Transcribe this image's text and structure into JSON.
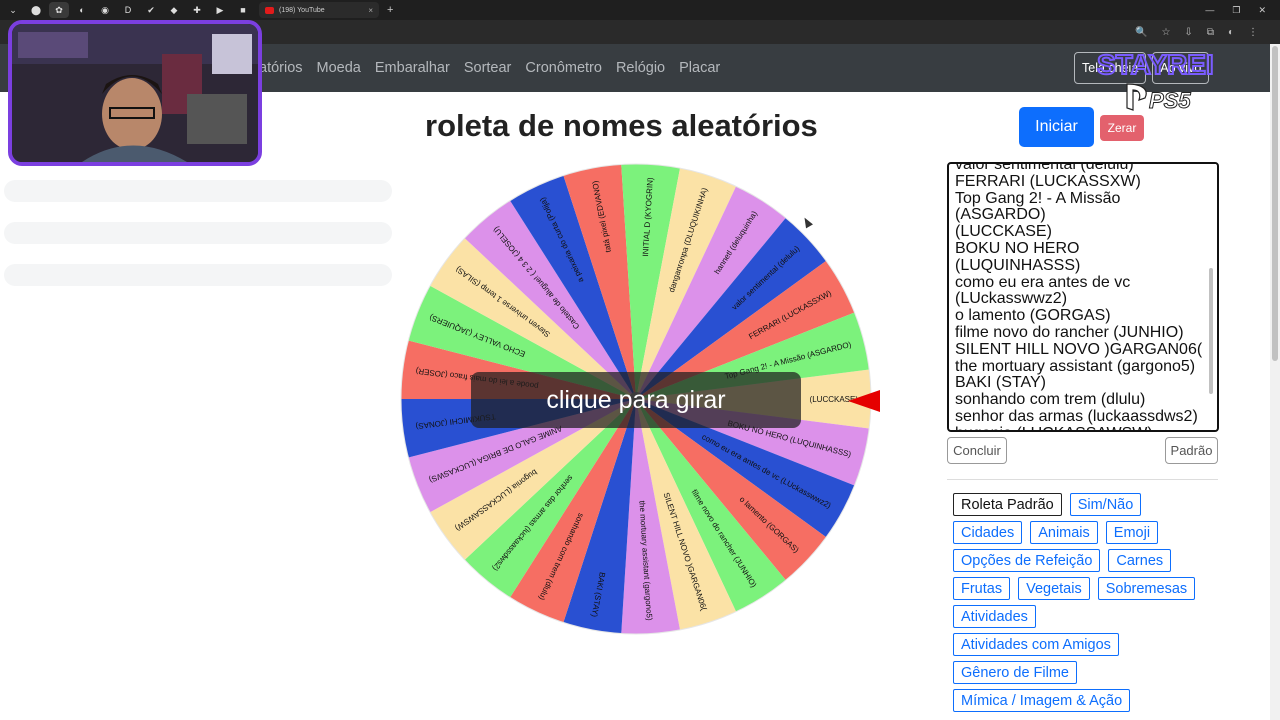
{
  "browser": {
    "tab_title": "(198) YouTube",
    "tab_close": "×",
    "new_tab": "+",
    "tab_icons": [
      "⌄",
      "⬤",
      "✿",
      "◐",
      "◉",
      "D",
      "✔",
      "◆",
      "✚",
      "▶",
      "■"
    ],
    "window_controls": [
      "—",
      "❐",
      "✕"
    ],
    "address_icons": [
      "🔍",
      "☆",
      "⇩",
      "⧉",
      "◐",
      "⋮"
    ]
  },
  "nav": {
    "links": [
      "atórios",
      "Moeda",
      "Embaralhar",
      "Sortear",
      "Cronômetro",
      "Relógio",
      "Placar"
    ],
    "buttons": [
      "Tela cheia",
      "Ao vivo"
    ]
  },
  "brand": {
    "overlay_text": "STAYREI",
    "logo_text": "PS5"
  },
  "page": {
    "title": "roleta de nomes aleatórios"
  },
  "controls": {
    "start": "Iniciar",
    "reset": "Zerar"
  },
  "wheel": {
    "overlay": "clique para girar",
    "colors": {
      "green": "#7cf27c",
      "cream": "#fbe2a6",
      "violet": "#dc91ea",
      "blue": "#2950d2",
      "coral": "#f66e63"
    },
    "segments": [
      {
        "label": "(LUCCKASE)",
        "color": "cream"
      },
      {
        "label": "BOKU NO HERO (LUQUINHASSS)",
        "color": "violet"
      },
      {
        "label": "como eu era antes de vc (LUckasswwz2)",
        "color": "blue"
      },
      {
        "label": "o lamento (GORGAS)",
        "color": "coral"
      },
      {
        "label": "filme novo do rancher (JUNHIO)",
        "color": "green"
      },
      {
        "label": "SILENT HILL NOVO )GARGAN06(",
        "color": "cream"
      },
      {
        "label": "the mortuary assistant (gargono5)",
        "color": "violet"
      },
      {
        "label": "BAKI (STAY)",
        "color": "blue"
      },
      {
        "label": "sonhando com trem (dlulu)",
        "color": "coral"
      },
      {
        "label": "senhor das armas (luckaassdws2)",
        "color": "green"
      },
      {
        "label": "bugonia (LUCKASSAWSW)",
        "color": "cream"
      },
      {
        "label": "ANIME GALO DE BRIGA (LUCKASWS)",
        "color": "violet"
      },
      {
        "label": "TSUKIMICHI (JONAS)",
        "color": "blue"
      },
      {
        "label": "poode a lei do mais fraco (JOSER)",
        "color": "coral"
      },
      {
        "label": "ECHO VALLEY (JAQUIERS)",
        "color": "green"
      },
      {
        "label": "Steven universe 1 temp (SILAS)",
        "color": "cream"
      },
      {
        "label": "Castelo de alugue! ( 2 3 4 (JOSELU)",
        "color": "violet"
      },
      {
        "label": "a peixaria do curta (Polija)",
        "color": "blue"
      },
      {
        "label": "tatá pixel (EDVANO)",
        "color": "coral"
      },
      {
        "label": "INITIAL D (KYOGRIN)",
        "color": "green"
      },
      {
        "label": "danganronpa (DLUQUIKINHA)",
        "color": "cream"
      },
      {
        "label": "hannetl (deluquinha)",
        "color": "violet"
      },
      {
        "label": "valor sentimental (delulu)",
        "color": "blue"
      },
      {
        "label": "FERRARI (LUCKASSXW)",
        "color": "coral"
      },
      {
        "label": "Top Gang 2! - A Missão (ASGARDO)",
        "color": "green"
      }
    ]
  },
  "names_list": [
    "valor sentimental (delulu)",
    "FERRARI (LUCKASSXW)",
    "Top Gang 2! - A Missão (ASGARDO)",
    "(LUCCKASE)",
    "BOKU NO HERO (LUQUINHASSS)",
    "como eu era antes de vc (LUckasswwz2)",
    "o lamento (GORGAS)",
    "filme novo do rancher (JUNHIO)",
    "SILENT HILL NOVO )GARGAN06(",
    "the mortuary assistant (gargono5)",
    "BAKI (STAY)",
    "sonhando com trem (dlulu)",
    "senhor das armas (luckaassdws2)",
    "bugonia (LUCKASSAWSW)"
  ],
  "list_buttons": {
    "conclude": "Concluir",
    "default": "Padrão"
  },
  "presets": [
    {
      "label": "Roleta Padrão",
      "active": true
    },
    {
      "label": "Sim/Não"
    },
    {
      "label": "Cidades"
    },
    {
      "label": "Animais"
    },
    {
      "label": "Emoji"
    },
    {
      "label": "Opções de Refeição"
    },
    {
      "label": "Carnes"
    },
    {
      "label": "Frutas"
    },
    {
      "label": "Vegetais"
    },
    {
      "label": "Sobremesas"
    },
    {
      "label": "Atividades"
    },
    {
      "label": "Atividades com Amigos"
    },
    {
      "label": "Gênero de Filme"
    },
    {
      "label": "Mímica / Imagem & Ação"
    }
  ]
}
